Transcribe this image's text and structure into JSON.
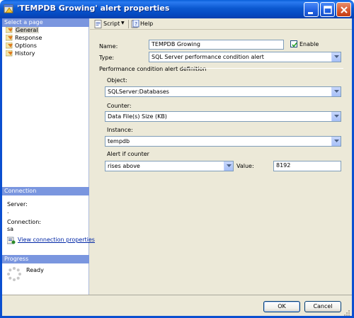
{
  "window": {
    "title": "'TEMPDB Growing' alert properties"
  },
  "nav": {
    "header": "Select a page",
    "items": [
      {
        "label": "General",
        "selected": true
      },
      {
        "label": "Response",
        "selected": false
      },
      {
        "label": "Options",
        "selected": false
      },
      {
        "label": "History",
        "selected": false
      }
    ]
  },
  "connection": {
    "header": "Connection",
    "server_label": "Server:",
    "server_value": ".",
    "connection_label": "Connection:",
    "connection_value": "sa",
    "link": "View connection properties"
  },
  "progress": {
    "header": "Progress",
    "status": "Ready"
  },
  "toolbar": {
    "script": "Script",
    "help": "Help"
  },
  "form": {
    "name_label": "Name:",
    "name_value": "TEMPDB Growing",
    "enable_label": "Enable",
    "enable_checked": true,
    "type_label": "Type:",
    "type_value": "SQL Server performance condition alert",
    "group_title": "Performance condition alert definition",
    "object_label": "Object:",
    "object_value": "SQLServer:Databases",
    "counter_label": "Counter:",
    "counter_value": "Data File(s) Size (KB)",
    "instance_label": "Instance:",
    "instance_value": "tempdb",
    "alert_if_label": "Alert if counter",
    "alert_if_value": "rises above",
    "value_label": "Value:",
    "value_value": "8192"
  },
  "buttons": {
    "ok": "OK",
    "cancel": "Cancel"
  }
}
